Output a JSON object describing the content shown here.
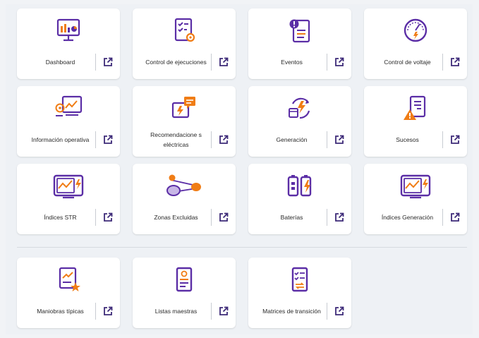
{
  "cards": [
    {
      "label": "Dashboard",
      "icon": "dashboard-monitor-icon"
    },
    {
      "label": "Control de ejecuciones",
      "icon": "checklist-gear-icon"
    },
    {
      "label": "Eventos",
      "icon": "event-alert-document-icon"
    },
    {
      "label": "Control de voltaje",
      "icon": "voltage-gauge-icon"
    },
    {
      "label": "Información operativa",
      "icon": "gear-chart-monitor-icon"
    },
    {
      "label": "Recomendacione s eléctricas",
      "icon": "chat-lightning-icon"
    },
    {
      "label": "Generación",
      "icon": "cycle-lightning-icon"
    },
    {
      "label": "Sucesos",
      "icon": "warning-document-icon"
    },
    {
      "label": "Índices STR",
      "icon": "str-chart-monitor-icon"
    },
    {
      "label": "Zonas Excluidas",
      "icon": "excluded-zones-icon"
    },
    {
      "label": "Baterías",
      "icon": "batteries-icon"
    },
    {
      "label": "Índices Generación",
      "icon": "generation-chart-monitor-icon"
    }
  ],
  "bottom_cards": [
    {
      "label": "Maniobras típicas",
      "icon": "chart-star-document-icon"
    },
    {
      "label": "Listas maestras",
      "icon": "master-list-document-icon"
    },
    {
      "label": "Matrices de transición",
      "icon": "transition-matrix-document-icon"
    }
  ],
  "colors": {
    "purple": "#5b2ea6",
    "orange": "#f07d16"
  }
}
